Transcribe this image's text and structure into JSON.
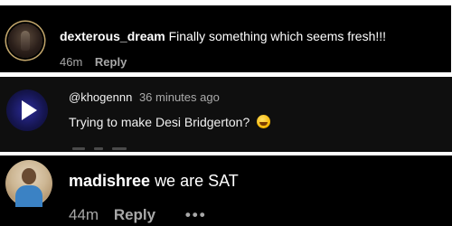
{
  "comments": [
    {
      "username": "dexterous_dream",
      "text": "Finally something which seems fresh!!!",
      "time": "46m",
      "reply_label": "Reply"
    },
    {
      "handle": "@khogennn",
      "time": "36 minutes ago",
      "text": "Trying to make Desi Bridgerton?",
      "emoji_icon": "grinning-sweat-emoji"
    },
    {
      "username": "madishree",
      "text": "we are SAT",
      "time": "44m",
      "reply_label": "Reply",
      "more_label": "•••"
    }
  ],
  "colors": {
    "panel_bg": "#000000",
    "youtube_bg": "#0f0f0f",
    "text_primary": "#ffffff",
    "text_secondary": "#a8a8a8"
  }
}
